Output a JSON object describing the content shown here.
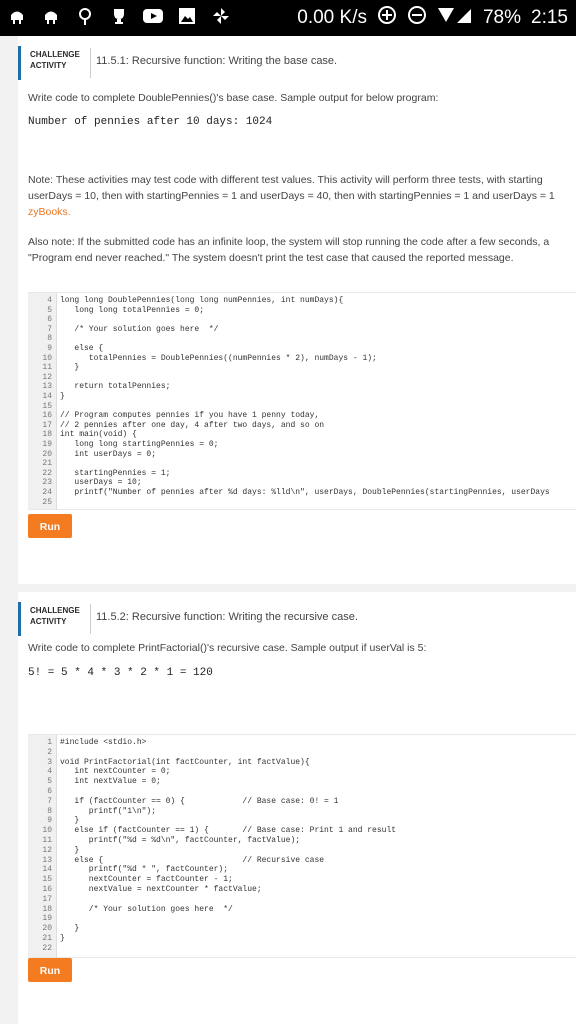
{
  "status_bar": {
    "icons": [
      "android-icon",
      "android-icon",
      "location-icon",
      "trophy-icon",
      "youtube-icon",
      "image-icon",
      "pinwheel-icon"
    ],
    "net_speed": "0.00 K/s",
    "battery": "78%",
    "time": "2:15"
  },
  "activity1": {
    "tag_line1": "CHALLENGE",
    "tag_line2": "ACTIVITY",
    "title": "11.5.1: Recursive function: Writing the base case.",
    "instruction": "Write code to complete DoublePennies()'s base case. Sample output for below program:",
    "sample_output": "Number of pennies after 10 days: 1024",
    "note_line1": "Note: These activities may test code with different test values. This activity will perform three tests, with starting",
    "note_line2": "userDays = 10, then with startingPennies = 1 and userDays = 40, then with startingPennies = 1 and userDays = 1",
    "note_link": "zyBooks.",
    "also_line1": "Also note: If the submitted code has an infinite loop, the system will stop running the code after a few seconds, a",
    "also_line2": "\"Program end never reached.\" The system doesn't print the test case that caused the reported message.",
    "code_lines": [
      {
        "n": "4",
        "t": "long long DoublePennies(long long numPennies, int numDays){"
      },
      {
        "n": "5",
        "t": "   long long totalPennies = 0;"
      },
      {
        "n": "6",
        "t": ""
      },
      {
        "n": "7",
        "t": "   /* Your solution goes here  */"
      },
      {
        "n": "8",
        "t": ""
      },
      {
        "n": "9",
        "t": "   else {"
      },
      {
        "n": "10",
        "t": "      totalPennies = DoublePennies((numPennies * 2), numDays - 1);"
      },
      {
        "n": "11",
        "t": "   }"
      },
      {
        "n": "12",
        "t": ""
      },
      {
        "n": "13",
        "t": "   return totalPennies;"
      },
      {
        "n": "14",
        "t": "}"
      },
      {
        "n": "15",
        "t": ""
      },
      {
        "n": "16",
        "t": "// Program computes pennies if you have 1 penny today,"
      },
      {
        "n": "17",
        "t": "// 2 pennies after one day, 4 after two days, and so on"
      },
      {
        "n": "18",
        "t": "int main(void) {"
      },
      {
        "n": "19",
        "t": "   long long startingPennies = 0;"
      },
      {
        "n": "20",
        "t": "   int userDays = 0;"
      },
      {
        "n": "21",
        "t": ""
      },
      {
        "n": "22",
        "t": "   startingPennies = 1;"
      },
      {
        "n": "23",
        "t": "   userDays = 10;"
      },
      {
        "n": "24",
        "t": "   printf(\"Number of pennies after %d days: %lld\\n\", userDays, DoublePennies(startingPennies, userDays"
      },
      {
        "n": "25",
        "t": ""
      }
    ],
    "run_label": "Run"
  },
  "activity2": {
    "tag_line1": "CHALLENGE",
    "tag_line2": "ACTIVITY",
    "title": "11.5.2: Recursive function: Writing the recursive case.",
    "instruction": "Write code to complete PrintFactorial()'s recursive case. Sample output if userVal is 5:",
    "sample_output": "5! = 5 * 4 * 3 * 2 * 1 = 120",
    "code_lines": [
      {
        "n": "1",
        "t": "#include <stdio.h>"
      },
      {
        "n": "2",
        "t": ""
      },
      {
        "n": "3",
        "t": "void PrintFactorial(int factCounter, int factValue){"
      },
      {
        "n": "4",
        "t": "   int nextCounter = 0;"
      },
      {
        "n": "5",
        "t": "   int nextValue = 0;"
      },
      {
        "n": "6",
        "t": ""
      },
      {
        "n": "7",
        "t": "   if (factCounter == 0) {            // Base case: 0! = 1"
      },
      {
        "n": "8",
        "t": "      printf(\"1\\n\");"
      },
      {
        "n": "9",
        "t": "   }"
      },
      {
        "n": "10",
        "t": "   else if (factCounter == 1) {       // Base case: Print 1 and result"
      },
      {
        "n": "11",
        "t": "      printf(\"%d = %d\\n\", factCounter, factValue);"
      },
      {
        "n": "12",
        "t": "   }"
      },
      {
        "n": "13",
        "t": "   else {                             // Recursive case"
      },
      {
        "n": "14",
        "t": "      printf(\"%d * \", factCounter);"
      },
      {
        "n": "15",
        "t": "      nextCounter = factCounter - 1;"
      },
      {
        "n": "16",
        "t": "      nextValue = nextCounter * factValue;"
      },
      {
        "n": "17",
        "t": ""
      },
      {
        "n": "18",
        "t": "      /* Your solution goes here  */"
      },
      {
        "n": "19",
        "t": ""
      },
      {
        "n": "20",
        "t": "   }"
      },
      {
        "n": "21",
        "t": "}"
      },
      {
        "n": "22",
        "t": ""
      }
    ],
    "run_label": "Run"
  }
}
